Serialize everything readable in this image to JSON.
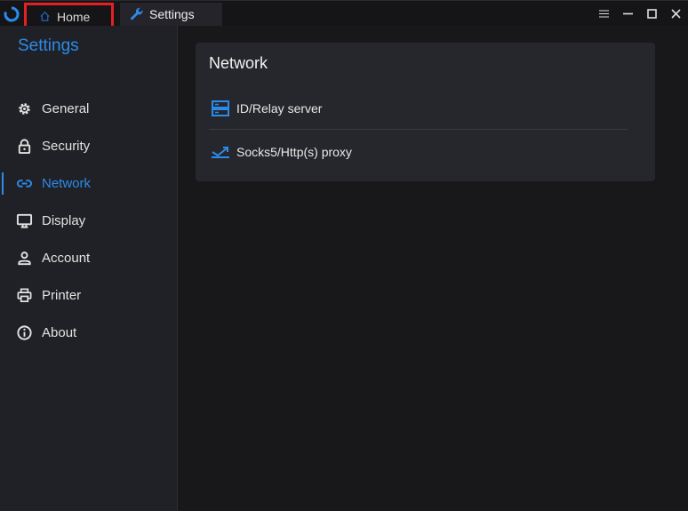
{
  "tabs": [
    {
      "label": "Home",
      "icon": "home-icon"
    },
    {
      "label": "Settings",
      "icon": "wrench-icon"
    }
  ],
  "window_controls": [
    "menu-icon",
    "minimize-icon",
    "maximize-icon",
    "close-icon"
  ],
  "sidebar": {
    "title": "Settings",
    "items": [
      {
        "label": "General",
        "icon": "gear-icon"
      },
      {
        "label": "Security",
        "icon": "lock-icon"
      },
      {
        "label": "Network",
        "icon": "link-icon",
        "active": true
      },
      {
        "label": "Display",
        "icon": "monitor-icon"
      },
      {
        "label": "Account",
        "icon": "person-icon"
      },
      {
        "label": "Printer",
        "icon": "printer-icon"
      },
      {
        "label": "About",
        "icon": "info-icon"
      }
    ]
  },
  "card": {
    "title": "Network",
    "rows": [
      {
        "label": "ID/Relay server",
        "icon": "server-icon"
      },
      {
        "label": "Socks5/Http(s) proxy",
        "icon": "proxy-icon"
      }
    ]
  },
  "colors": {
    "accent": "#2b8bea",
    "highlight_border": "#e52025"
  }
}
